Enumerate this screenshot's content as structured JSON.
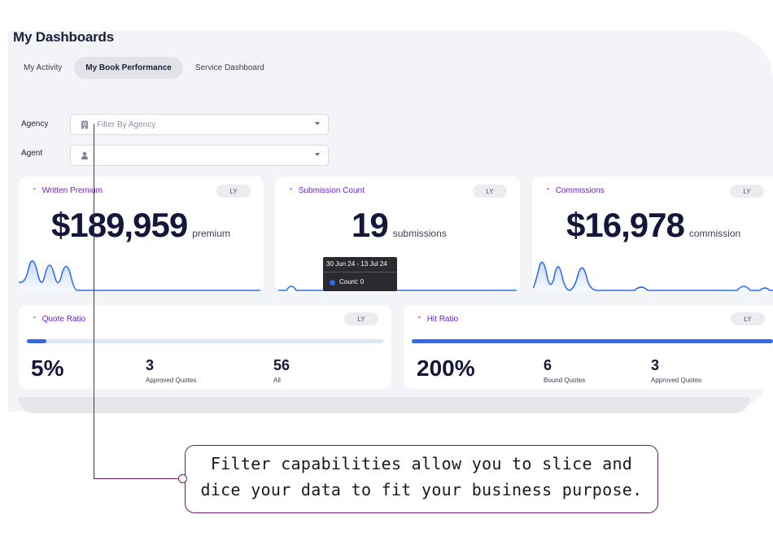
{
  "page": {
    "title": "My Dashboards"
  },
  "tabs": [
    {
      "label": "My Activity",
      "active": false
    },
    {
      "label": "My Book Performance",
      "active": true
    },
    {
      "label": "Service Dashboard",
      "active": false
    }
  ],
  "filters": {
    "agency": {
      "label": "Agency",
      "placeholder": "Filter By Agency",
      "icon": "building-icon"
    },
    "agent": {
      "label": "Agent",
      "placeholder": "",
      "icon": "person-icon"
    }
  },
  "cards": {
    "written_premium": {
      "title": "Written Premium",
      "ly": "LY",
      "value": "$189,959",
      "unit": "premium"
    },
    "submission_count": {
      "title": "Submission Count",
      "ly": "LY",
      "value": "19",
      "unit": "submissions"
    },
    "commissions": {
      "title": "Commissions",
      "ly": "LY",
      "value": "$16,978",
      "unit": "commission"
    }
  },
  "tooltip": {
    "date_range": "30 Jun 24 - 13 Jul 24",
    "count_text": "Count: 0"
  },
  "ratios": {
    "quote_ratio": {
      "title": "Quote Ratio",
      "ly": "LY",
      "value": "5%",
      "progress": 0.05,
      "stat1": {
        "value": "3",
        "label": "Approved Quotes"
      },
      "stat2": {
        "value": "56",
        "label": "All"
      }
    },
    "hit_ratio": {
      "title": "Hit Ratio",
      "ly": "LY",
      "value": "200%",
      "progress": 1.0,
      "stat1": {
        "value": "6",
        "label": "Bound Quotes"
      },
      "stat2": {
        "value": "3",
        "label": "Approved Quotes"
      }
    }
  },
  "callout": {
    "line1": "Filter capabilities allow you to slice and",
    "line2": "dice your data to fit your business purpose."
  },
  "colors": {
    "accent": "#6a1fd0",
    "chart": "#2f6bf0",
    "callout": "#6b1f5e"
  }
}
